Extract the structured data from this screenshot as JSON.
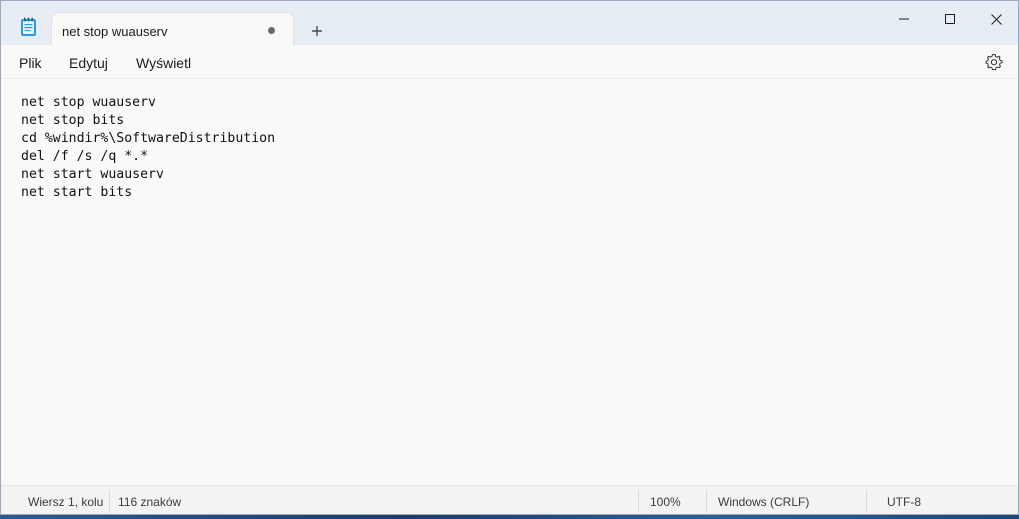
{
  "window": {
    "tab_title": "net stop wuauserv",
    "new_tab_icon": "plus-icon",
    "controls": [
      "minimize-icon",
      "maximize-icon",
      "close-icon"
    ]
  },
  "menu": {
    "items": [
      "Plik",
      "Edytuj",
      "Wyświetl"
    ],
    "settings_icon": "gear-icon"
  },
  "editor": {
    "lines": [
      "net stop wuauserv",
      "net stop bits",
      "cd %windir%\\SoftwareDistribution",
      "del /f /s /q *.*",
      "net start wuauserv",
      "net start bits"
    ]
  },
  "status": {
    "position": "Wiersz 1, kolu",
    "chars": "116 znaków",
    "zoom": "100%",
    "line_ending": "Windows (CRLF)",
    "encoding": "UTF-8"
  },
  "colors": {
    "titlebar": "#e7edf5",
    "background": "#f9f9f9",
    "statusbar": "#f3f3f3"
  }
}
